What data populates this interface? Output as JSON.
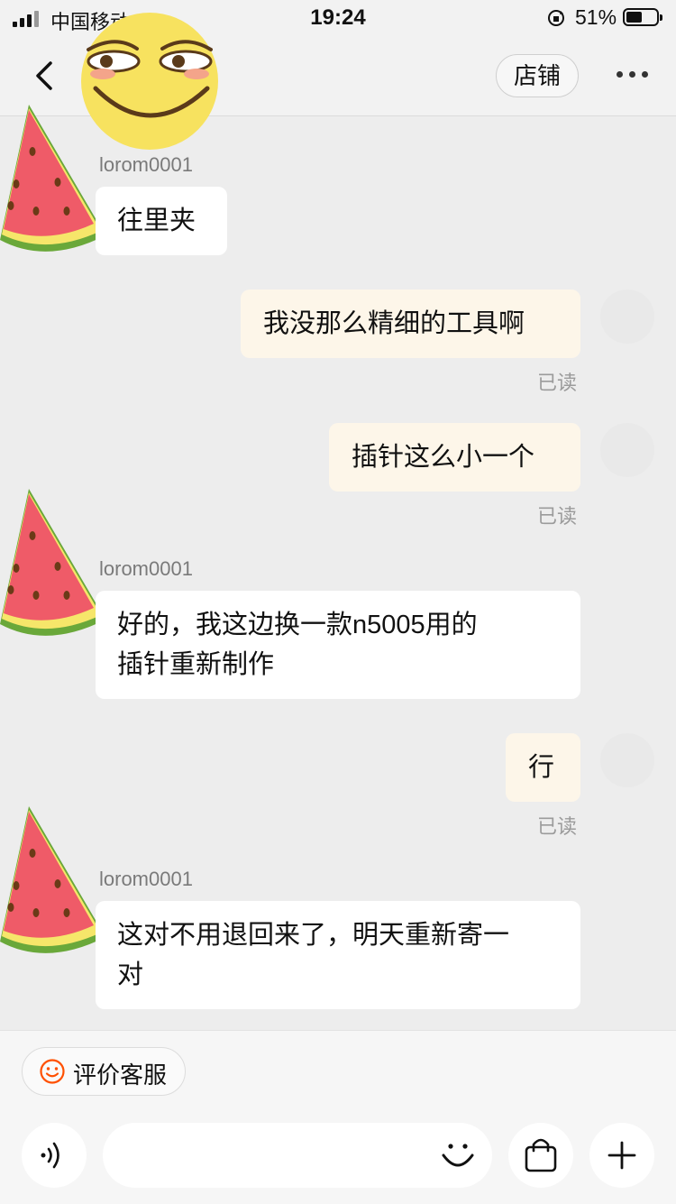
{
  "status_bar": {
    "carrier": "中国移动",
    "time": "19:24",
    "battery_percent": "51%",
    "battery_level": 0.51
  },
  "nav": {
    "shop_button": "店铺",
    "back_icon": "chevron-left-icon",
    "more_icon": "more-dots-icon"
  },
  "messages": [
    {
      "side": "left",
      "sender": "lorom0001",
      "lines": [
        "往里夹"
      ]
    },
    {
      "side": "right",
      "lines": [
        "我没那么精细的工具啊"
      ],
      "status": "已读"
    },
    {
      "side": "right",
      "lines": [
        "插针这么小一个"
      ],
      "status": "已读"
    },
    {
      "side": "left",
      "sender": "lorom0001",
      "lines": [
        "好的，我这边换一款n5005用的",
        "插针重新制作"
      ]
    },
    {
      "side": "right",
      "lines": [
        "行"
      ],
      "status": "已读"
    },
    {
      "side": "left",
      "sender": "lorom0001",
      "lines": [
        "这对不用退回来了，明天重新寄一",
        "对"
      ]
    }
  ],
  "bottom_bar": {
    "rate_service": "评价客服",
    "voice_icon": "voice-icon",
    "emoji_icon": "smile-icon",
    "bag_icon": "shopping-bag-icon",
    "plus_icon": "plus-icon"
  },
  "colors": {
    "background": "#ededed",
    "left_bubble": "#ffffff",
    "right_bubble": "#fdf6e9",
    "accent_orange": "#ff5000"
  }
}
